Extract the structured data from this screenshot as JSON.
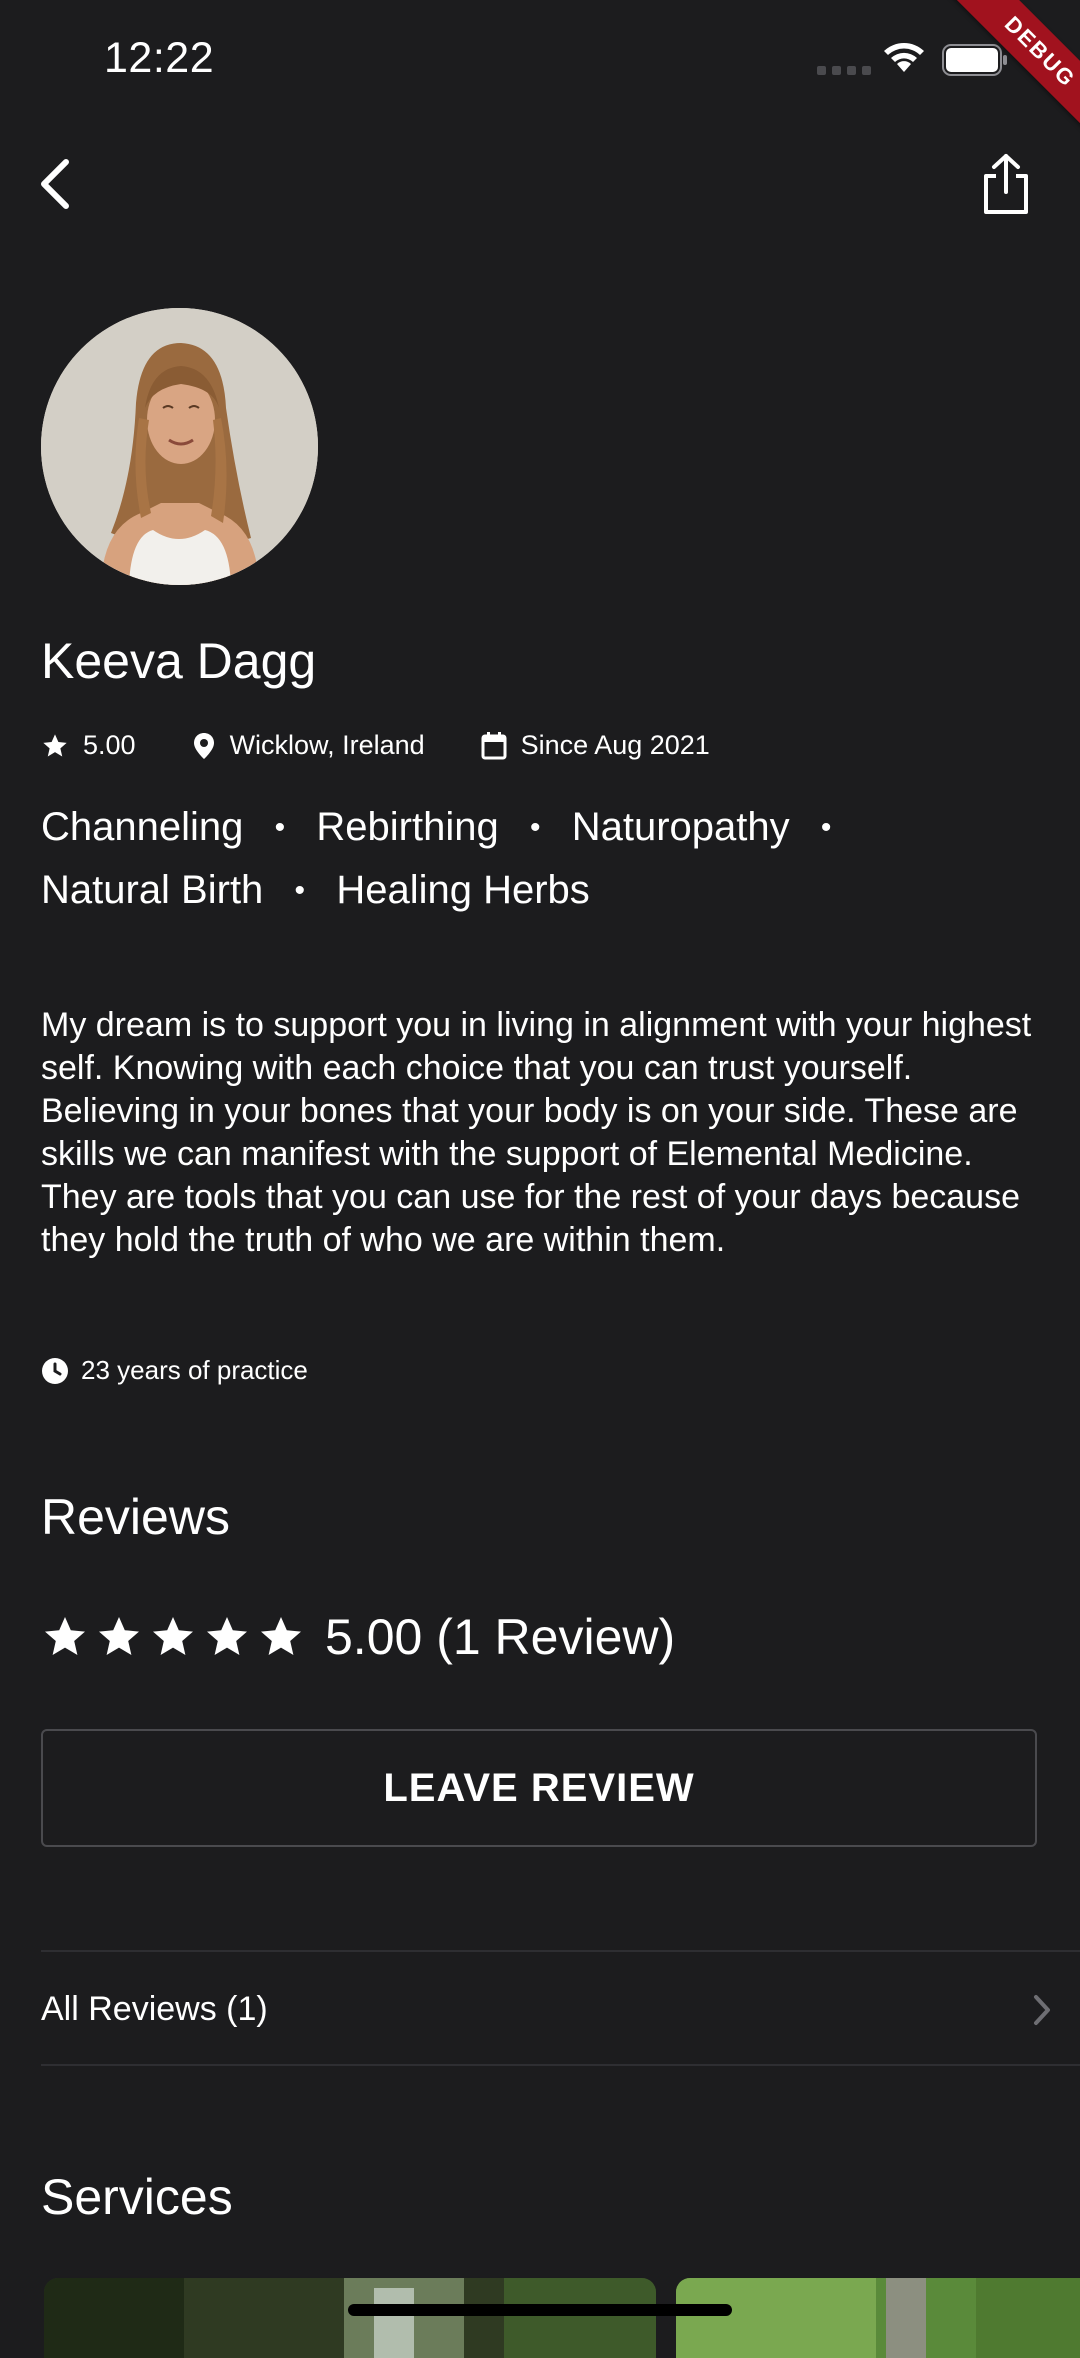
{
  "status_bar": {
    "time": "12:22"
  },
  "debug_banner": "DEBUG",
  "profile": {
    "name": "Keeva Dagg",
    "rating": "5.00",
    "location": "Wicklow, Ireland",
    "since": "Since Aug 2021",
    "tags": [
      "Channeling",
      "Rebirthing",
      "Naturopathy",
      "Natural Birth",
      "Healing Herbs"
    ],
    "bio": "My dream is to support you in living in alignment with your highest self. Knowing with each choice that you can trust yourself. Believing in your bones that your body is on your side. These are skills we can manifest with the support of Elemental Medicine. They are tools that you can use for the rest of your days because they hold the truth of who we are within them.",
    "practice": "23 years of practice"
  },
  "reviews": {
    "heading": "Reviews",
    "star_count": 5,
    "summary": "5.00 (1 Review)",
    "leave_review_label": "LEAVE REVIEW",
    "all_reviews_label": "All Reviews (1)"
  },
  "services": {
    "heading": "Services"
  },
  "colors": {
    "background": "#1c1c1e",
    "text": "#ffffff",
    "divider": "#2e2e32",
    "debug": "#a1121e"
  },
  "icons": [
    "back-icon",
    "share-icon",
    "star-icon",
    "location-pin-icon",
    "calendar-icon",
    "clock-icon",
    "chevron-right-icon",
    "wifi-icon",
    "battery-icon"
  ]
}
